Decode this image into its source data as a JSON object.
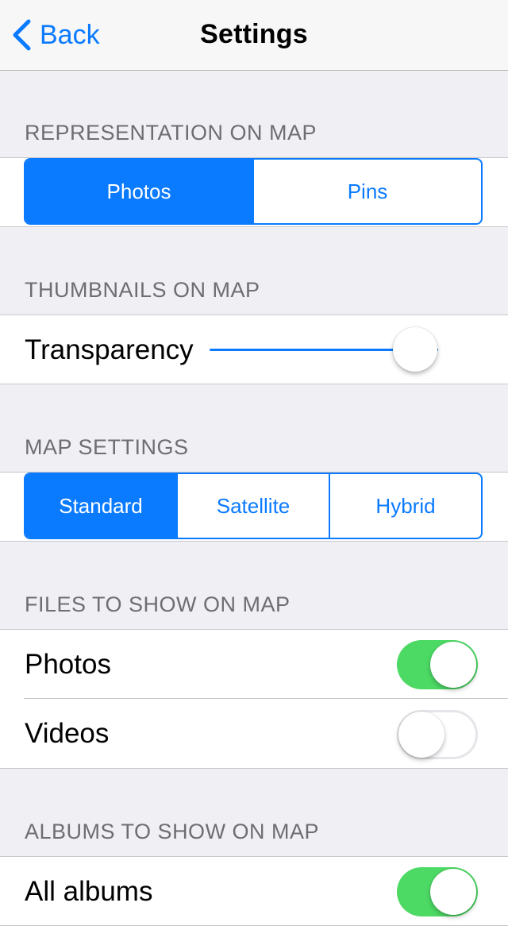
{
  "navbar": {
    "back_label": "Back",
    "title": "Settings"
  },
  "representation": {
    "header": "REPRESENTATION ON MAP",
    "options": [
      "Photos",
      "Pins"
    ],
    "selected": "Photos"
  },
  "thumbnails": {
    "header": "THUMBNAILS ON MAP",
    "transparency_label": "Transparency",
    "transparency_value": 0.9
  },
  "map_settings": {
    "header": "MAP SETTINGS",
    "options": [
      "Standard",
      "Satellite",
      "Hybrid"
    ],
    "selected": "Standard"
  },
  "files": {
    "header": "FILES TO SHOW ON MAP",
    "photos_label": "Photos",
    "photos_on": true,
    "videos_label": "Videos",
    "videos_on": false
  },
  "albums": {
    "header": "ALBUMS TO SHOW ON MAP",
    "all_albums_label": "All albums",
    "all_albums_on": true
  },
  "colors": {
    "accent": "#0a7aff",
    "switch_on": "#4cd964",
    "background": "#efeff4"
  },
  "icons": {
    "back": "chevron-left-icon"
  }
}
